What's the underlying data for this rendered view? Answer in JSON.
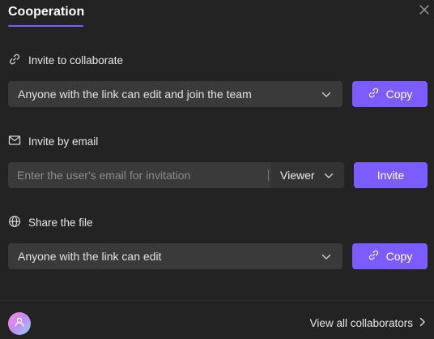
{
  "header": {
    "tab_title": "Cooperation",
    "close_icon": "close-icon"
  },
  "invite_link": {
    "label": "Invite to collaborate",
    "icon": "link-icon",
    "permission_value": "Anyone with the link can edit and join the team",
    "copy_label": "Copy"
  },
  "invite_email": {
    "label": "Invite by email",
    "icon": "mail-icon",
    "placeholder": "Enter the user's email for invitation",
    "role_value": "Viewer",
    "invite_label": "Invite"
  },
  "share_file": {
    "label": "Share the file",
    "icon": "globe-icon",
    "permission_value": "Anyone with the link can edit",
    "copy_label": "Copy"
  },
  "footer": {
    "view_all_label": "View all collaborators"
  },
  "colors": {
    "background": "#232324",
    "accent": "#7c5cff",
    "field": "#3a3a3b"
  }
}
